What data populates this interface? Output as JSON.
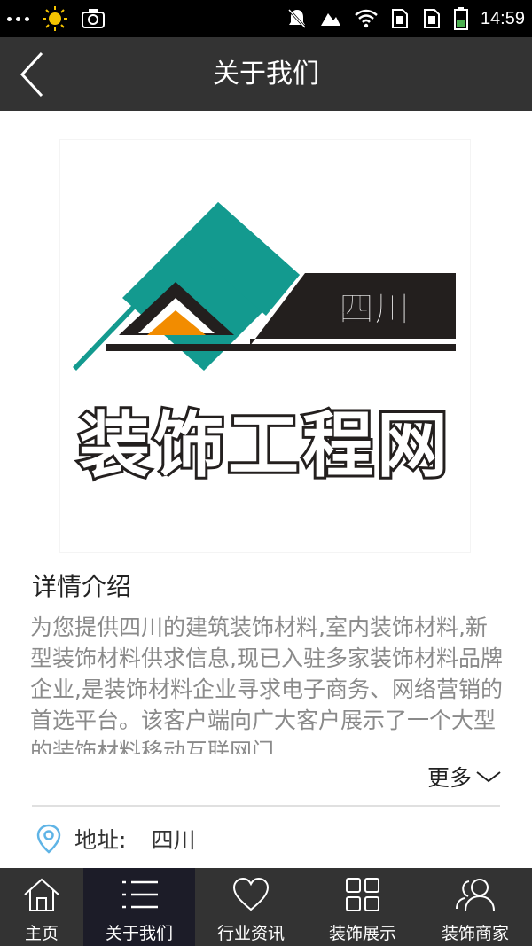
{
  "status_bar": {
    "time": "14:59"
  },
  "nav": {
    "title": "关于我们"
  },
  "logo": {
    "region_text": "四川",
    "brand_text": "装饰工程网",
    "colors": {
      "teal": "#139a8f",
      "dark": "#231f1e",
      "orange": "#f28c00"
    }
  },
  "details": {
    "title": "详情介绍",
    "text": "为您提供四川的建筑装饰材料,室内装饰材料,新型装饰材料供求信息,现已入驻多家装饰材料品牌企业,是装饰材料企业寻求电子商务、网络营销的首选平台。该客户端向广大客户展示了一个大型的装饰材料移动互联网门...",
    "more_label": "更多"
  },
  "address": {
    "label": "地址:",
    "value": "四川"
  },
  "tabs": [
    {
      "label": "主页",
      "icon": "home-icon",
      "active": false
    },
    {
      "label": "关于我们",
      "icon": "list-icon",
      "active": true
    },
    {
      "label": "行业资讯",
      "icon": "heart-icon",
      "active": false
    },
    {
      "label": "装饰展示",
      "icon": "grid-icon",
      "active": false
    },
    {
      "label": "装饰商家",
      "icon": "users-icon",
      "active": false
    }
  ],
  "colors": {
    "bar_bg": "#333333",
    "active_tab_bg": "#1c1c28",
    "body_text": "#8a8a8a",
    "location_icon": "#5fb4e6"
  }
}
